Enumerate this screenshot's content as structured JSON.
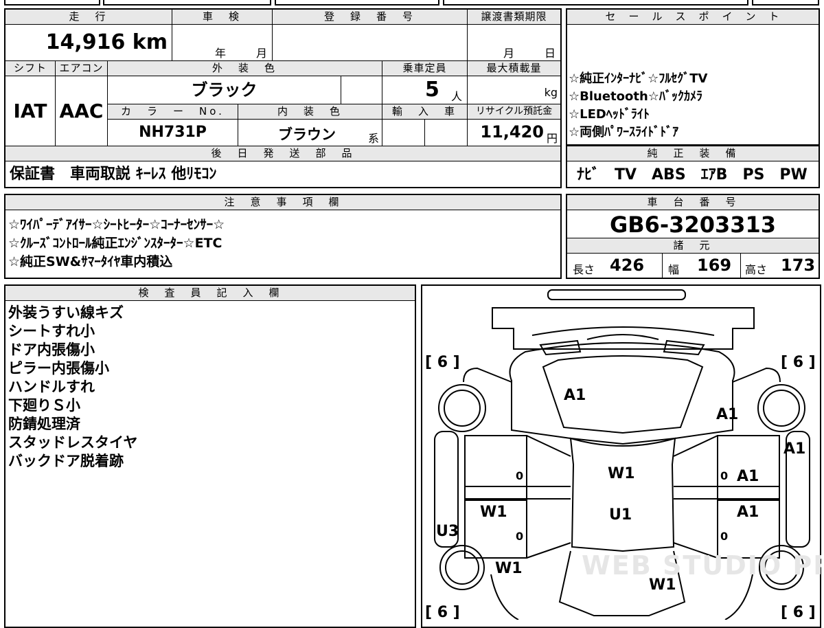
{
  "vehicle": {
    "mileage_label": "走　行",
    "mileage_value": "14,916 km",
    "inspection_label": "車　検",
    "inspection_year_unit": "年",
    "inspection_month_unit": "月",
    "registration_label": "登　録　番　号",
    "transfer_label": "譲渡書類期限",
    "transfer_month_unit": "月",
    "transfer_day_unit": "日",
    "shift_label": "シフト",
    "shift_value": "IAT",
    "ac_label": "エアコン",
    "ac_value": "AAC",
    "exterior_color_label": "外　装　色",
    "exterior_color_value": "ブラック",
    "capacity_label": "乗車定員",
    "capacity_value": "5",
    "capacity_unit": "人",
    "max_load_label": "最大積載量",
    "max_load_unit": "kg",
    "color_no_label": "カ　ラ　ー　No.",
    "color_no_value": "NH731P",
    "interior_color_label": "内　装　色",
    "interior_color_value": "ブラウン",
    "interior_color_suffix": "系",
    "import_label": "輸　入　車",
    "recycle_label": "リサイクル預託金",
    "recycle_value": "11,420",
    "recycle_unit": "円"
  },
  "sales_points": {
    "label": "セ　ー　ル　ス　ポ　イ　ン　ト",
    "lines": [
      "☆純正ｲﾝﾀｰﾅﾋﾞ☆ﾌﾙｾｸﾞTV",
      "☆Bluetooth☆ﾊﾞｯｸｶﾒﾗ",
      "☆LEDﾍｯﾄﾞﾗｲﾄ",
      "☆両側ﾊﾟﾜｰｽﾗｲﾄﾞﾄﾞｱ"
    ]
  },
  "later_parts": {
    "label": "後　日　発　送　部　品",
    "value": "保証書　車両取説 ｷｰﾚｽ 他ﾘﾓｺﾝ"
  },
  "genuine_equipment": {
    "label": "純　正　装　備",
    "value": "ﾅﾋﾞ　TV　ABS　ｴｱB　PS　PW"
  },
  "notes": {
    "label": "注　意　事　項　欄",
    "lines": [
      "☆ﾜｲﾊﾟｰﾃﾞｱｲｻｰ☆ｼｰﾄﾋｰﾀｰ☆ｺｰﾅｰｾﾝｻｰ☆",
      "☆ｸﾙｰｽﾞｺﾝﾄﾛｰﾙ純正ｴﾝｼﾞﾝｽﾀｰﾀｰ☆ETC",
      "☆純正SW&ｻﾏｰﾀｲﾔ車内積込"
    ]
  },
  "chassis": {
    "label": "車　台　番　号",
    "value": "GB6-3203313"
  },
  "dimensions": {
    "label": "諸　元",
    "length_label": "長さ",
    "length_value": "426",
    "width_label": "幅",
    "width_value": "169",
    "height_label": "高さ",
    "height_value": "173"
  },
  "inspector": {
    "label": "検　査　員　記　入　欄",
    "lines": [
      "外装うすい線キズ",
      "シートすれ小",
      "ドア内張傷小",
      "ピラー内張傷小",
      "ハンドルすれ",
      "下廻りＳ小",
      "防錆処理済",
      "スタッドレスタイヤ",
      "バックドア脱着跡"
    ]
  },
  "diagram": {
    "tire_marks": [
      "[ 6 ]",
      "[ 6 ]",
      "[ 6 ]",
      "[ 6 ]"
    ],
    "marks": [
      "A1",
      "A1",
      "A1",
      "A1",
      "A1",
      "W1",
      "W1",
      "U1",
      "W1",
      "W1",
      "U3"
    ],
    "zero_marks": [
      "0",
      "0",
      "0",
      "0"
    ],
    "watermark": "WEB STUDIO PRO"
  }
}
